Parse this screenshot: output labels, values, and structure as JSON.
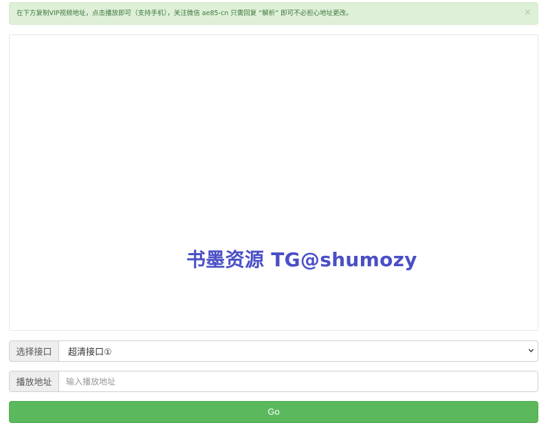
{
  "alert": {
    "message": "在下方复制VIP视频地址，点击播放即可（支持手机），关注微信 ae85-cn 只需回复 “解析” 即可不必担心地址更改。",
    "close": "×"
  },
  "player": {
    "watermark": "书墨资源  TG@shumozy"
  },
  "interface_select": {
    "label": "选择接口",
    "value": "超清接口①"
  },
  "url_input": {
    "label": "播放地址",
    "placeholder": "输入播放地址",
    "value": ""
  },
  "go_button": {
    "label": "Go"
  },
  "colors": {
    "alert_bg": "#dff0d8",
    "alert_text": "#3c763d",
    "watermark": "#4a4fc6",
    "button_bg": "#5cb85c"
  }
}
